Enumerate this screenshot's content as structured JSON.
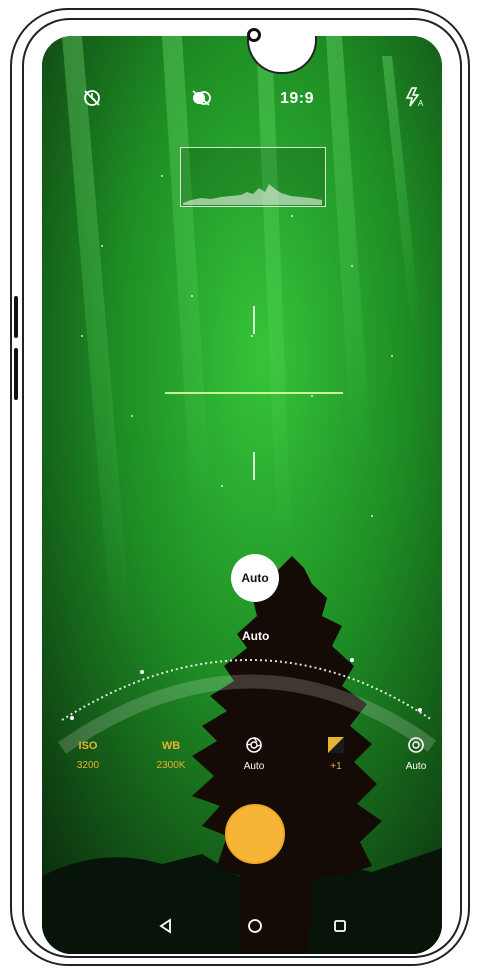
{
  "topbar": {
    "timer_icon": "timer-off-icon",
    "filter_icon": "filter-off-icon",
    "ratio": "19:9",
    "flash_icon": "flash-auto-icon"
  },
  "focus": {
    "bubble_label": "Auto",
    "dial_label": "Auto"
  },
  "controls": [
    {
      "label": "ISO",
      "value": "3200",
      "active": true
    },
    {
      "label": "WB",
      "value": "2300K",
      "active": true
    },
    {
      "label": "",
      "value": "Auto",
      "icon": "shutter-speed-icon",
      "active": false
    },
    {
      "label": "",
      "value": "+1",
      "icon": "exposure-icon",
      "active": true
    },
    {
      "label": "",
      "value": "Auto",
      "icon": "focus-icon",
      "active": false
    }
  ],
  "colors": {
    "accent": "#f7b538",
    "active_text": "#e9b332",
    "sky_green": "#22a52b",
    "white": "#ffffff"
  },
  "navbar": {
    "back_icon": "back-triangle-icon",
    "home_icon": "home-circle-icon",
    "recents_icon": "recents-square-icon"
  }
}
